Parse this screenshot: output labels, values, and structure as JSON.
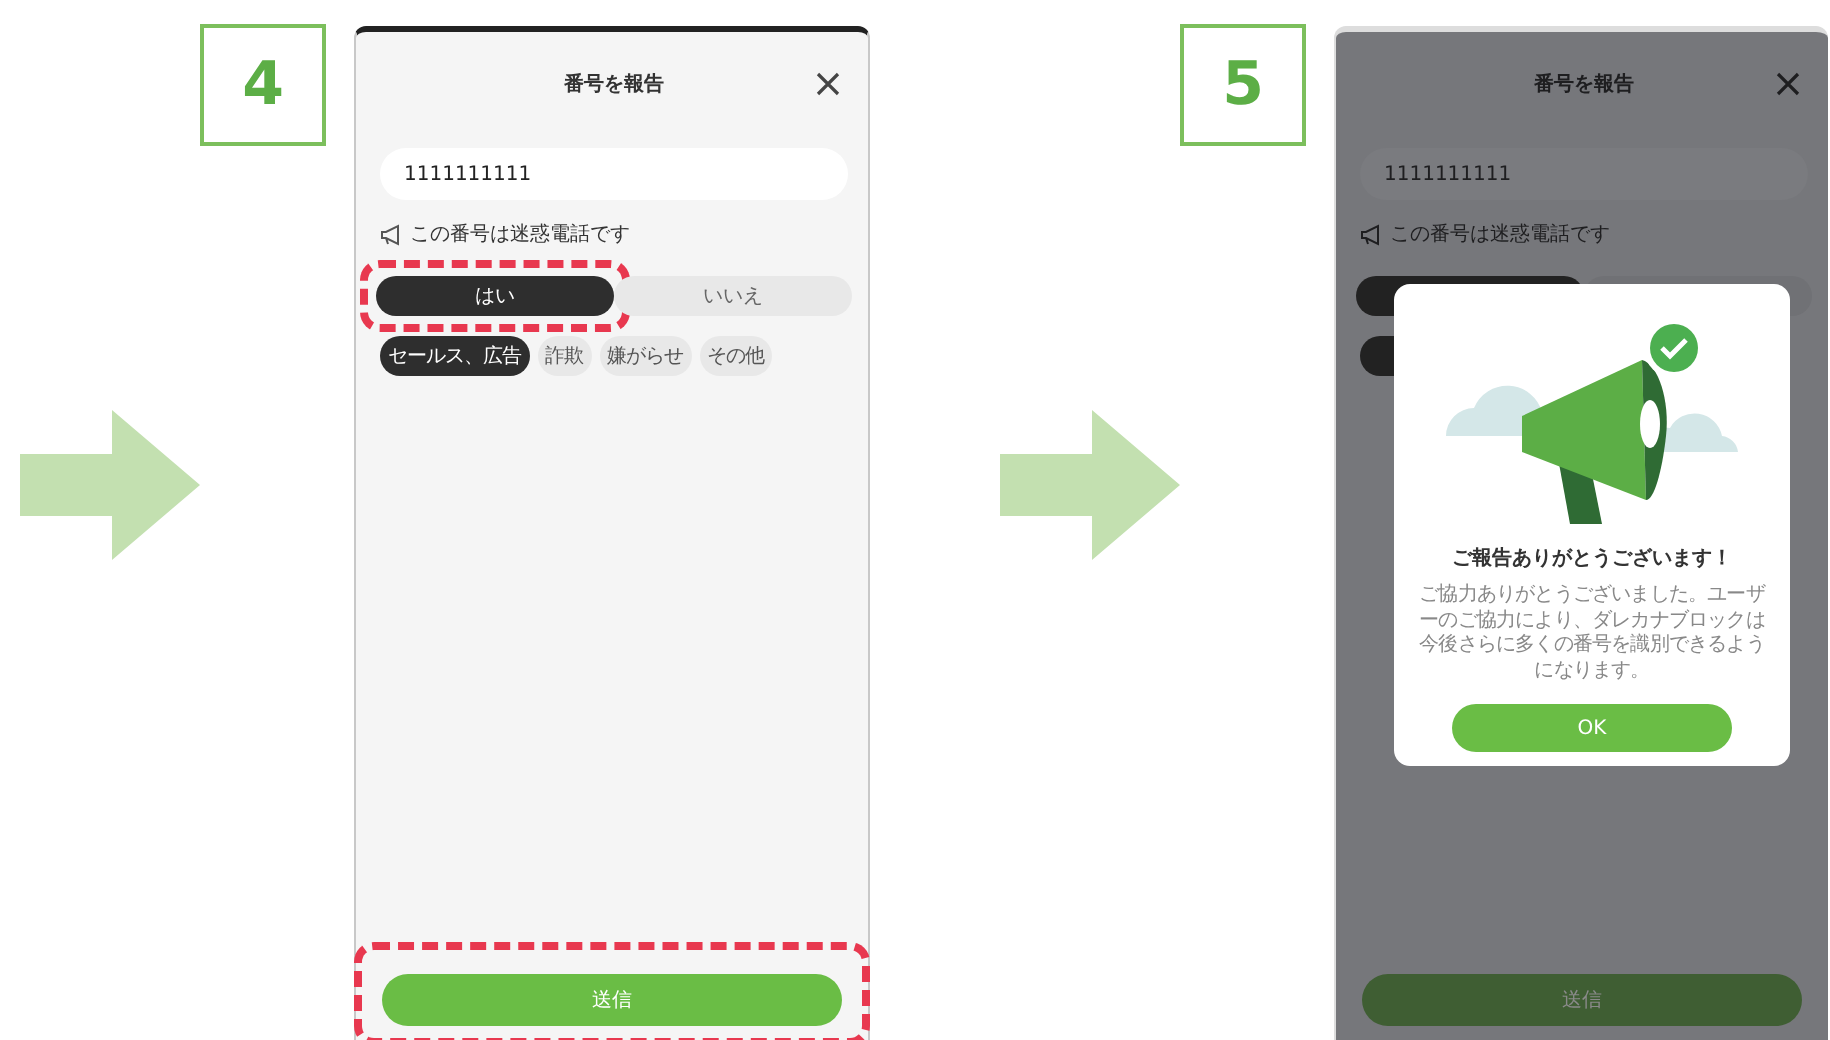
{
  "steps": [
    {
      "number": "4",
      "screen": {
        "title": "番号を報告",
        "dimmed": false,
        "phone_number": "1111111111",
        "question": "この番号は迷惑電話です",
        "choices": [
          {
            "label": "はい",
            "selected": true,
            "highlighted": true
          },
          {
            "label": "いいえ",
            "selected": false,
            "highlighted": false
          }
        ],
        "categories": [
          {
            "label": "セールス、広告",
            "selected": true
          },
          {
            "label": "詐欺",
            "selected": false
          },
          {
            "label": "嫌がらせ",
            "selected": false
          },
          {
            "label": "その他",
            "selected": false
          }
        ],
        "submit": {
          "label": "送信",
          "highlighted": true
        }
      }
    },
    {
      "number": "5",
      "screen": {
        "title": "番号を報告",
        "dimmed": true,
        "phone_number": "1111111111",
        "question": "この番号は迷惑電話です",
        "choices": [
          {
            "selected": true,
            "highlighted": false
          },
          {
            "selected": false,
            "highlighted": false
          }
        ],
        "categories": [
          {
            "selected": true
          }
        ],
        "submit": {
          "label": "送信",
          "highlighted": false
        },
        "popup": {
          "title": "ご報告ありがとうございます！",
          "message": "ご協力ありがとうございました。ユーザーのご協力により、ダレカナブロックは今後さらに多くの番号を識別できるようになります。",
          "button": "OK"
        }
      }
    }
  ]
}
